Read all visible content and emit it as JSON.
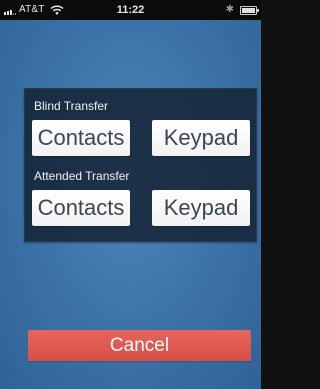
{
  "status_bar": {
    "carrier": "AT&T",
    "time": "11:22",
    "signal_icon": "signal-bars-icon",
    "wifi_icon": "wifi-icon",
    "bluetooth_icon": "bluetooth-icon",
    "battery_icon": "battery-icon"
  },
  "transfer": {
    "blind": {
      "label": "Blind Transfer",
      "contacts_label": "Contacts",
      "keypad_label": "Keypad"
    },
    "attended": {
      "label": "Attended Transfer",
      "contacts_label": "Contacts",
      "keypad_label": "Keypad"
    }
  },
  "cancel_label": "Cancel",
  "colors": {
    "background": "#3e75aa",
    "panel": "#122030",
    "button": "#ffffff",
    "button_text": "#3e4650",
    "cancel": "#e0594f"
  }
}
